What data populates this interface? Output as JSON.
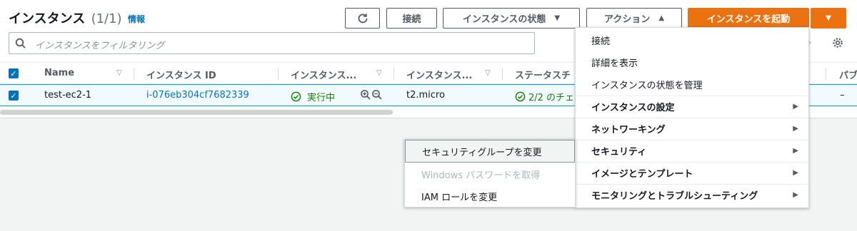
{
  "header": {
    "title": "インスタンス",
    "count": "(1/1)",
    "info_link": "情報"
  },
  "toolbar": {
    "connect_label": "接続",
    "instance_state_label": "インスタンスの状態",
    "actions_label": "アクション",
    "launch_label": "インスタンスを起動",
    "dropdown_caret": "▼",
    "up_caret": "▲"
  },
  "search": {
    "placeholder": "インスタンスをフィルタリング"
  },
  "table": {
    "columns": [
      "Name",
      "インスタンス ID",
      "インスタンス...",
      "インスタンス...",
      "ステータスチ",
      "パブ"
    ],
    "sort_glyph": "▽",
    "rows": [
      {
        "checked": "✓",
        "name": "test-ec2-1",
        "instance_id": "i-076eb304cf7682339",
        "state": "実行中",
        "instance_type": "t2.micro",
        "status_check": "2/2 のチェ",
        "public_dns": "–"
      }
    ]
  },
  "actions_menu": {
    "items": [
      {
        "label": "接続",
        "bold": false,
        "submenu": false
      },
      {
        "label": "詳細を表示",
        "bold": false,
        "submenu": false
      },
      {
        "label": "インスタンスの状態を管理",
        "bold": false,
        "submenu": false
      },
      {
        "label": "インスタンスの設定",
        "bold": true,
        "submenu": true
      },
      {
        "label": "ネットワーキング",
        "bold": true,
        "submenu": true
      },
      {
        "label": "セキュリティ",
        "bold": true,
        "submenu": true
      },
      {
        "label": "イメージとテンプレート",
        "bold": true,
        "submenu": true
      },
      {
        "label": "モニタリングとトラブルシューティング",
        "bold": true,
        "submenu": true
      }
    ],
    "submenu_arrow": "▶"
  },
  "security_submenu": {
    "items": [
      {
        "label": "セキュリティグループを変更",
        "state": "hover"
      },
      {
        "label": "Windows パスワードを取得",
        "state": "disabled"
      },
      {
        "label": "IAM ロールを変更",
        "state": "normal"
      }
    ]
  },
  "colors": {
    "primary": "#ec7211",
    "link": "#0073bb",
    "success": "#1d8102",
    "selected_row": "#f1faff"
  }
}
